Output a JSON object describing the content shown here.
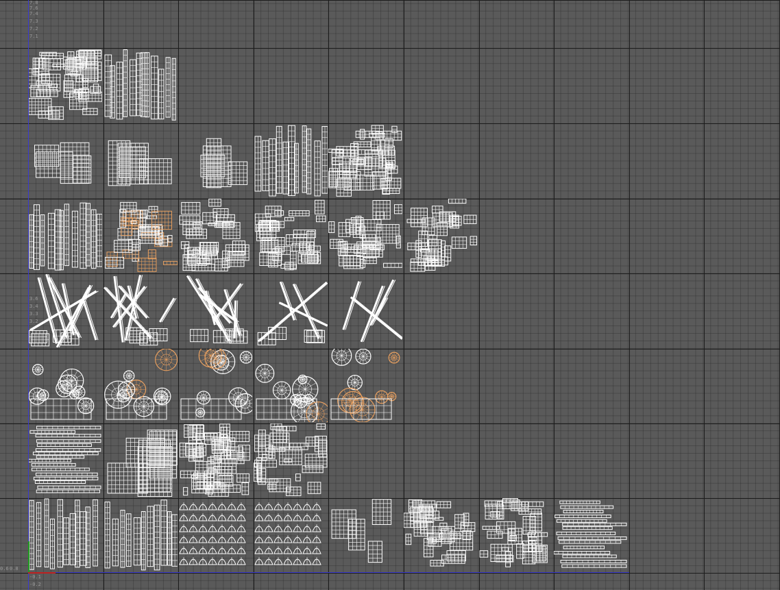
{
  "viewport": {
    "axis_color": "#3a3ad0",
    "u_axis_color": "#c02020",
    "v_axis_color": "#20a020",
    "background_color": "#5a5a5a",
    "grid_color": "#1c1c1c",
    "wire_color": "#ffffff",
    "selected_wire_color": "#e8a060"
  },
  "v_ticks_top": [
    "7.8",
    "7.6",
    "7.4",
    "7.3",
    "7.2",
    "7.1"
  ],
  "v_ticks_mid": [
    "3.6",
    "3.4",
    "3.3",
    "3.2"
  ],
  "v_ticks_bottom": [
    "-0.1",
    "-0.2"
  ],
  "u_ticks_left": [
    "0.6",
    "0.8"
  ],
  "tiles": [
    {
      "col": 0,
      "row": 1,
      "style": "dense-scraps",
      "selected": false
    },
    {
      "col": 1,
      "row": 1,
      "style": "strips",
      "selected": false
    },
    {
      "col": 0,
      "row": 2,
      "style": "panels",
      "selected": false
    },
    {
      "col": 1,
      "row": 2,
      "style": "panels",
      "selected": false
    },
    {
      "col": 2,
      "row": 2,
      "style": "grid-blocks",
      "selected": false
    },
    {
      "col": 3,
      "row": 2,
      "style": "strips",
      "selected": false
    },
    {
      "col": 4,
      "row": 2,
      "style": "dense-scraps",
      "selected": false
    },
    {
      "col": 0,
      "row": 3,
      "style": "strips",
      "selected": false
    },
    {
      "col": 1,
      "row": 3,
      "style": "mixed",
      "selected": true
    },
    {
      "col": 2,
      "row": 3,
      "style": "mixed",
      "selected": false
    },
    {
      "col": 3,
      "row": 3,
      "style": "mixed",
      "selected": false
    },
    {
      "col": 4,
      "row": 3,
      "style": "mixed",
      "selected": false
    },
    {
      "col": 5,
      "row": 3,
      "style": "mixed",
      "selected": false
    },
    {
      "col": 0,
      "row": 4,
      "style": "diagonals",
      "selected": false
    },
    {
      "col": 1,
      "row": 4,
      "style": "diagonals",
      "selected": false
    },
    {
      "col": 2,
      "row": 4,
      "style": "diagonals",
      "selected": false
    },
    {
      "col": 3,
      "row": 4,
      "style": "sparse",
      "selected": false
    },
    {
      "col": 4,
      "row": 4,
      "style": "long-diagonals",
      "selected": false
    },
    {
      "col": 0,
      "row": 5,
      "style": "circles",
      "selected": false
    },
    {
      "col": 1,
      "row": 5,
      "style": "circles",
      "selected": true
    },
    {
      "col": 2,
      "row": 5,
      "style": "circles",
      "selected": true
    },
    {
      "col": 3,
      "row": 5,
      "style": "circles",
      "selected": true
    },
    {
      "col": 4,
      "row": 5,
      "style": "circles",
      "selected": true
    },
    {
      "col": 0,
      "row": 6,
      "style": "horizontal-strips",
      "selected": false
    },
    {
      "col": 1,
      "row": 6,
      "style": "blocks",
      "selected": false
    },
    {
      "col": 2,
      "row": 6,
      "style": "dense-scraps",
      "selected": false
    },
    {
      "col": 3,
      "row": 6,
      "style": "mixed",
      "selected": false
    },
    {
      "col": 0,
      "row": 7,
      "style": "strips",
      "selected": false
    },
    {
      "col": 1,
      "row": 7,
      "style": "strips",
      "selected": false
    },
    {
      "col": 2,
      "row": 7,
      "style": "shells",
      "selected": false
    },
    {
      "col": 3,
      "row": 7,
      "style": "shells",
      "selected": false
    },
    {
      "col": 4,
      "row": 7,
      "style": "grid-blocks",
      "selected": false
    },
    {
      "col": 5,
      "row": 7,
      "style": "mixed",
      "selected": false
    },
    {
      "col": 6,
      "row": 7,
      "style": "mixed",
      "selected": false
    },
    {
      "col": 7,
      "row": 7,
      "style": "horizontal-strips",
      "selected": false
    }
  ]
}
